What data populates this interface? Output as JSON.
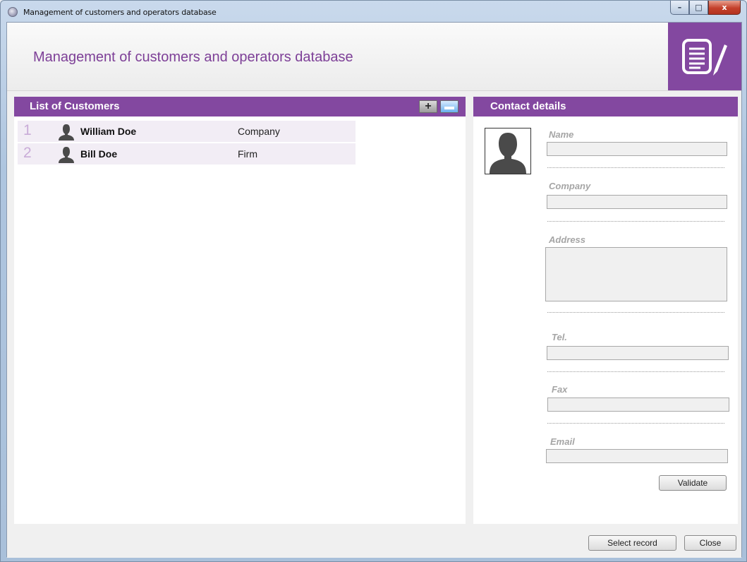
{
  "window": {
    "title": "Management of customers and operators database",
    "controls": {
      "minimize": "–",
      "maximize": "□",
      "close": "x"
    }
  },
  "header": {
    "title": "Management of customers and operators database",
    "logo_icon": "document-edit-icon"
  },
  "customers": {
    "title": "List of Customers",
    "add_icon": "plus-icon",
    "remove_icon": "minus-icon",
    "rows": [
      {
        "num": "1",
        "name": "William Doe",
        "company": "Company"
      },
      {
        "num": "2",
        "name": "Bill Doe",
        "company": "Firm"
      }
    ]
  },
  "contact": {
    "title": "Contact details",
    "photo_icon": "person-silhouette-icon",
    "fields": {
      "name": {
        "label": "Name",
        "value": ""
      },
      "company": {
        "label": "Company",
        "value": ""
      },
      "address": {
        "label": "Address",
        "value": ""
      },
      "tel": {
        "label": "Tel.",
        "value": ""
      },
      "fax": {
        "label": "Fax",
        "value": ""
      },
      "email": {
        "label": "Email",
        "value": ""
      }
    },
    "validate_label": "Validate"
  },
  "footer": {
    "select_label": "Select record",
    "close_label": "Close"
  },
  "colors": {
    "accent": "#8348a0",
    "row_bg": "#f2edf5",
    "row_number": "#c9acd8",
    "label_gray": "#a5a5a5"
  }
}
